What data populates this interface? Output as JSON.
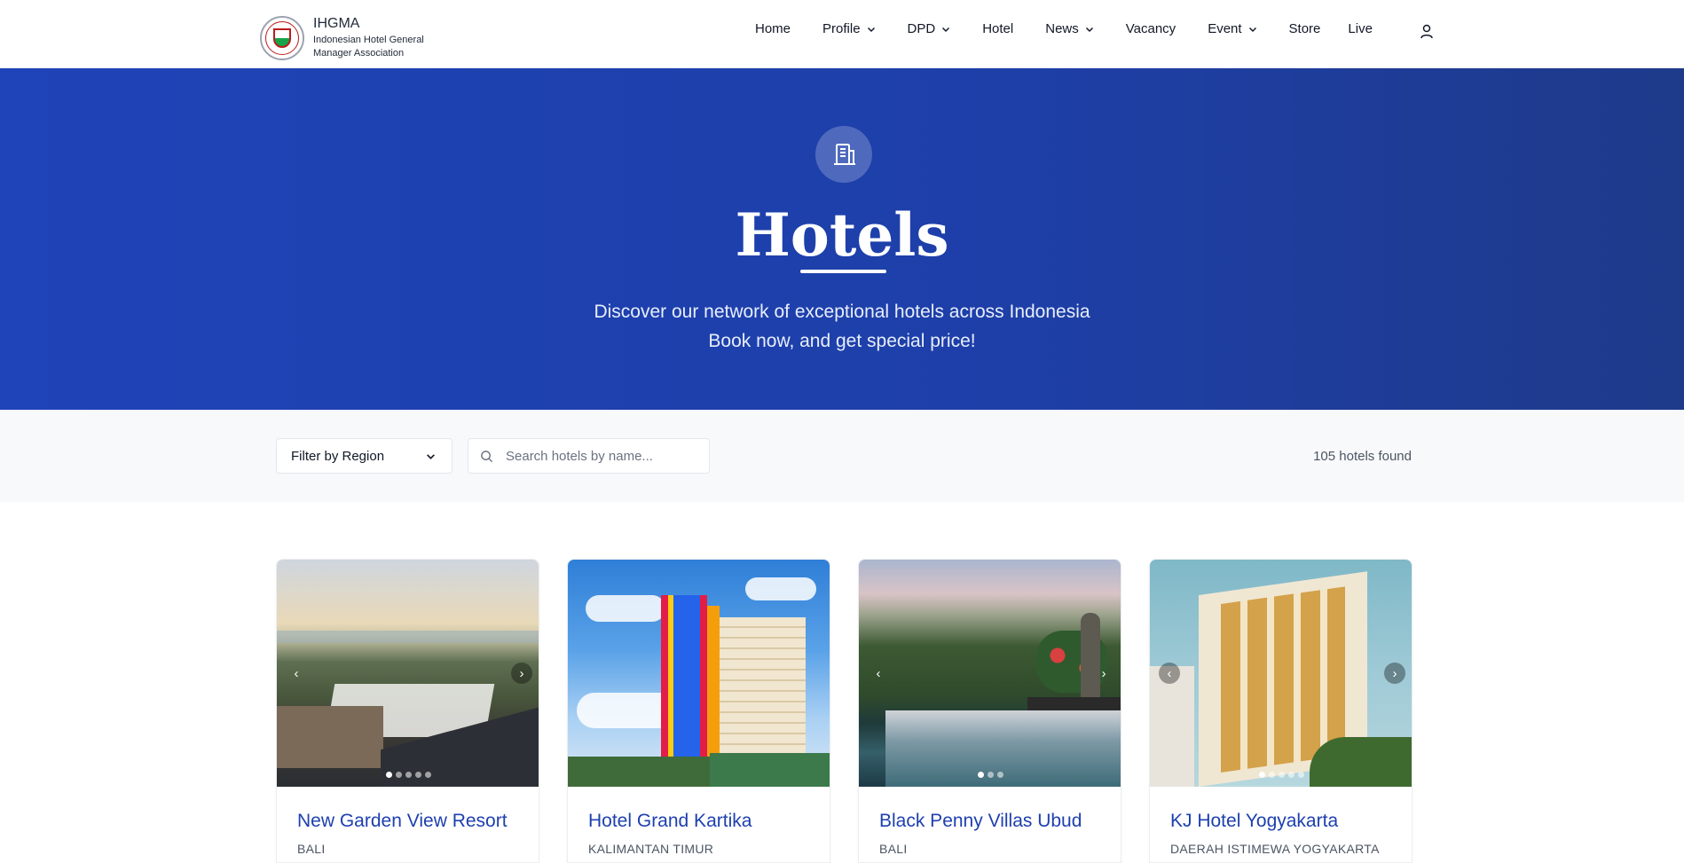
{
  "brand": {
    "title": "IHGMA",
    "subtitle": "Indonesian Hotel General Manager Association"
  },
  "nav": {
    "items": [
      {
        "label": "Home",
        "has_dropdown": false
      },
      {
        "label": "Profile",
        "has_dropdown": true
      },
      {
        "label": "DPD",
        "has_dropdown": true
      },
      {
        "label": "Hotel",
        "has_dropdown": false
      },
      {
        "label": "News",
        "has_dropdown": true
      },
      {
        "label": "Vacancy",
        "has_dropdown": false
      },
      {
        "label": "Event",
        "has_dropdown": true
      },
      {
        "label": "Store",
        "has_dropdown": false
      },
      {
        "label": "Live",
        "has_dropdown": false
      }
    ],
    "user_icon": "user-icon"
  },
  "hero": {
    "icon": "building-icon",
    "title": "Hotels",
    "subtitle_line1": "Discover our network of exceptional hotels across Indonesia",
    "subtitle_line2": "Book now, and get special price!"
  },
  "filters": {
    "region_select": "Filter by Region",
    "search_placeholder": "Search hotels by name...",
    "search_value": "",
    "results_count": "105 hotels found"
  },
  "hotels": [
    {
      "name": "New Garden View Resort",
      "region": "BALI",
      "slides": 5,
      "active_slide": 1
    },
    {
      "name": "Hotel Grand Kartika",
      "region": "KALIMANTAN TIMUR",
      "slides": 0,
      "active_slide": 0
    },
    {
      "name": "Black Penny Villas Ubud",
      "region": "BALI",
      "slides": 3,
      "active_slide": 1
    },
    {
      "name": "KJ Hotel Yogyakarta",
      "region": "DAERAH ISTIMEWA YOGYAKARTA",
      "slides": 5,
      "active_slide": 1
    }
  ],
  "colors": {
    "hero_bg": "#1f43b8",
    "link": "#1e40af",
    "filter_bg": "#f8f9fb"
  }
}
